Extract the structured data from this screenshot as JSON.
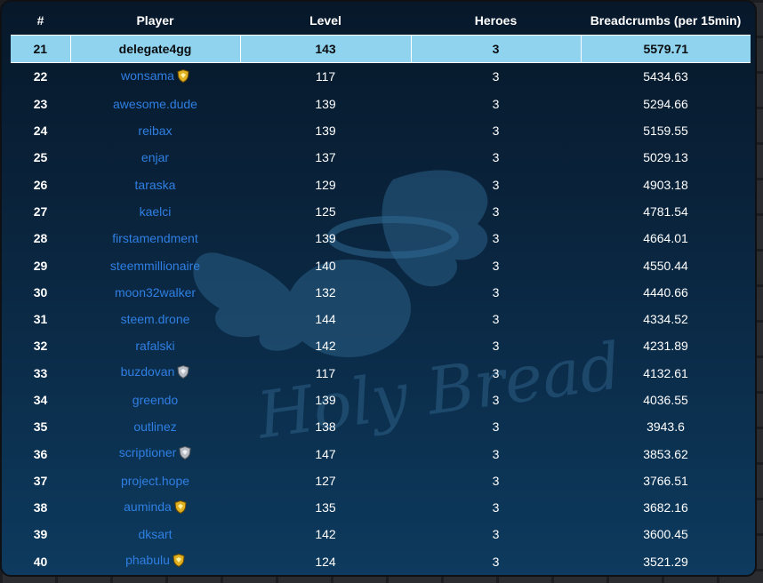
{
  "columns": {
    "rank": "#",
    "player": "Player",
    "level": "Level",
    "heroes": "Heroes",
    "breadcrumbs": "Breadcrumbs (per 15min)"
  },
  "watermark_text": "Holy Bread",
  "colors": {
    "highlight_row": "#8fd3ee",
    "player_link": "#2f7fe3",
    "badge_gold": "#e0b020",
    "badge_silver": "#b8bcc4"
  },
  "rows": [
    {
      "rank": "21",
      "player": "delegate4gg",
      "level": "143",
      "heroes": "3",
      "breadcrumbs": "5579.71",
      "badge": "none",
      "highlight": true
    },
    {
      "rank": "22",
      "player": "wonsama",
      "level": "117",
      "heroes": "3",
      "breadcrumbs": "5434.63",
      "badge": "gold-shield-icon"
    },
    {
      "rank": "23",
      "player": "awesome.dude",
      "level": "139",
      "heroes": "3",
      "breadcrumbs": "5294.66",
      "badge": "none"
    },
    {
      "rank": "24",
      "player": "reibax",
      "level": "139",
      "heroes": "3",
      "breadcrumbs": "5159.55",
      "badge": "none"
    },
    {
      "rank": "25",
      "player": "enjar",
      "level": "137",
      "heroes": "3",
      "breadcrumbs": "5029.13",
      "badge": "none"
    },
    {
      "rank": "26",
      "player": "taraska",
      "level": "129",
      "heroes": "3",
      "breadcrumbs": "4903.18",
      "badge": "none"
    },
    {
      "rank": "27",
      "player": "kaelci",
      "level": "125",
      "heroes": "3",
      "breadcrumbs": "4781.54",
      "badge": "none"
    },
    {
      "rank": "28",
      "player": "firstamendment",
      "level": "139",
      "heroes": "3",
      "breadcrumbs": "4664.01",
      "badge": "none"
    },
    {
      "rank": "29",
      "player": "steemmillionaire",
      "level": "140",
      "heroes": "3",
      "breadcrumbs": "4550.44",
      "badge": "none"
    },
    {
      "rank": "30",
      "player": "moon32walker",
      "level": "132",
      "heroes": "3",
      "breadcrumbs": "4440.66",
      "badge": "none"
    },
    {
      "rank": "31",
      "player": "steem.drone",
      "level": "144",
      "heroes": "3",
      "breadcrumbs": "4334.52",
      "badge": "none"
    },
    {
      "rank": "32",
      "player": "rafalski",
      "level": "142",
      "heroes": "3",
      "breadcrumbs": "4231.89",
      "badge": "none"
    },
    {
      "rank": "33",
      "player": "buzdovan",
      "level": "117",
      "heroes": "3",
      "breadcrumbs": "4132.61",
      "badge": "silver-shield-icon"
    },
    {
      "rank": "34",
      "player": "greendo",
      "level": "139",
      "heroes": "3",
      "breadcrumbs": "4036.55",
      "badge": "none"
    },
    {
      "rank": "35",
      "player": "outlinez",
      "level": "138",
      "heroes": "3",
      "breadcrumbs": "3943.6",
      "badge": "none"
    },
    {
      "rank": "36",
      "player": "scriptioner",
      "level": "147",
      "heroes": "3",
      "breadcrumbs": "3853.62",
      "badge": "silver-shield-icon"
    },
    {
      "rank": "37",
      "player": "project.hope",
      "level": "127",
      "heroes": "3",
      "breadcrumbs": "3766.51",
      "badge": "none"
    },
    {
      "rank": "38",
      "player": "auminda",
      "level": "135",
      "heroes": "3",
      "breadcrumbs": "3682.16",
      "badge": "gold-shield-icon"
    },
    {
      "rank": "39",
      "player": "dksart",
      "level": "142",
      "heroes": "3",
      "breadcrumbs": "3600.45",
      "badge": "none"
    },
    {
      "rank": "40",
      "player": "phabulu",
      "level": "124",
      "heroes": "3",
      "breadcrumbs": "3521.29",
      "badge": "gold-shield-icon"
    }
  ]
}
